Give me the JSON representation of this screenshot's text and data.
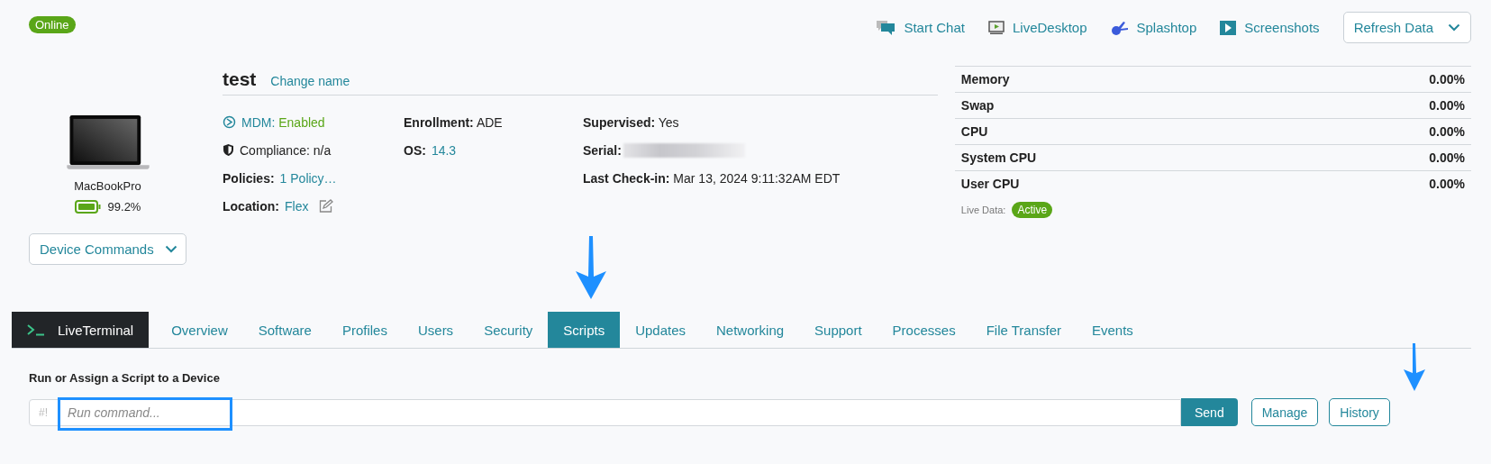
{
  "status_badge": "Online",
  "actions": [
    {
      "label": "Start Chat",
      "kind": "chat"
    },
    {
      "label": "LiveDesktop",
      "kind": "desktop"
    },
    {
      "label": "Splashtop",
      "kind": "splashtop"
    },
    {
      "label": "Screenshots",
      "kind": "screenshots"
    }
  ],
  "refresh_button": "Refresh Data",
  "device": {
    "model": "MacBookPro",
    "battery": "99.2%",
    "commands_button": "Device Commands"
  },
  "name": "test",
  "change_name": "Change name",
  "info_columns": [
    [
      {
        "kind": "status",
        "label": "MDM:",
        "value": "Enabled"
      },
      {
        "kind": "plain",
        "label": "Compliance:",
        "value": "n/a"
      },
      {
        "kind": "link",
        "label": "Policies:",
        "value": "1 Policy…"
      },
      {
        "kind": "editable",
        "label": "Location:",
        "value": "Flex"
      }
    ],
    [
      {
        "kind": "text",
        "label": "Enrollment:",
        "value": "ADE"
      },
      {
        "kind": "link",
        "label": "OS:",
        "value": "14.3"
      }
    ],
    [
      {
        "kind": "text",
        "label": "Supervised:",
        "value": "Yes"
      },
      {
        "kind": "redacted",
        "label": "Serial:"
      },
      {
        "kind": "text",
        "label": "Last Check-in:",
        "value": "Mar 13, 2024 9:11:32AM EDT"
      }
    ]
  ],
  "stats": [
    {
      "label": "Memory",
      "value": "0.00%"
    },
    {
      "label": "Swap",
      "value": "0.00%"
    },
    {
      "label": "CPU",
      "value": "0.00%"
    },
    {
      "label": "System CPU",
      "value": "0.00%"
    },
    {
      "label": "User CPU",
      "value": "0.00%"
    }
  ],
  "live_data": {
    "label": "Live Data:",
    "status": "Active"
  },
  "tabs": [
    {
      "label": "LiveTerminal",
      "kind": "terminal",
      "selected": false
    },
    {
      "label": "Overview",
      "kind": "tab",
      "selected": false
    },
    {
      "label": "Software",
      "kind": "tab",
      "selected": false
    },
    {
      "label": "Profiles",
      "kind": "tab",
      "selected": false
    },
    {
      "label": "Users",
      "kind": "tab",
      "selected": false
    },
    {
      "label": "Security",
      "kind": "tab",
      "selected": false
    },
    {
      "label": "Scripts",
      "kind": "tab",
      "selected": true
    },
    {
      "label": "Updates",
      "kind": "tab",
      "selected": false
    },
    {
      "label": "Networking",
      "kind": "tab",
      "selected": false
    },
    {
      "label": "Support",
      "kind": "tab",
      "selected": false
    },
    {
      "label": "Processes",
      "kind": "tab",
      "selected": false
    },
    {
      "label": "File Transfer",
      "kind": "tab",
      "selected": false
    },
    {
      "label": "Events",
      "kind": "tab",
      "selected": false
    }
  ],
  "script_panel": {
    "heading": "Run or Assign a Script to a Device",
    "prefix": "#!",
    "placeholder": "Run command...",
    "send": "Send",
    "manage": "Manage",
    "history": "History"
  }
}
